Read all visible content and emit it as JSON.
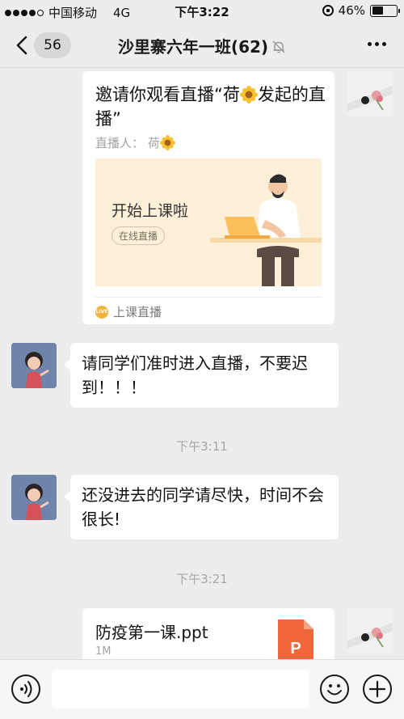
{
  "status_bar": {
    "carrier": "中国移动",
    "network": "4G",
    "time": "下午3:22",
    "battery": "46%",
    "battery_level": 0.46
  },
  "nav": {
    "unread_count": "56",
    "title": "沙里寨六年一班(62)"
  },
  "messages": {
    "live_card": {
      "title_part1": "邀请你观看直播“荷",
      "title_part2": "发起的直播”",
      "host_label": "直播人：",
      "host_name": "荷",
      "cover_headline": "开始上课啦",
      "cover_tag": "在线直播",
      "source_badge": "LIVE",
      "source": "上课直播"
    },
    "msg1": "请同学们准时进入直播，不要迟到！！！",
    "time1": "下午3:11",
    "msg2": "还没进去的同学请尽快，时间不会很长!",
    "time2": "下午3:21",
    "file_card": {
      "name": "防疫第一课.ppt",
      "size": "1M",
      "icon_letter": "P"
    }
  },
  "input_bar": {
    "placeholder": ""
  },
  "colors": {
    "background": "#ededed",
    "bubble": "#ffffff",
    "live_cover": "#fdf0d9",
    "ppt_orange": "#f2673a",
    "live_badge": "#f2b33d"
  }
}
